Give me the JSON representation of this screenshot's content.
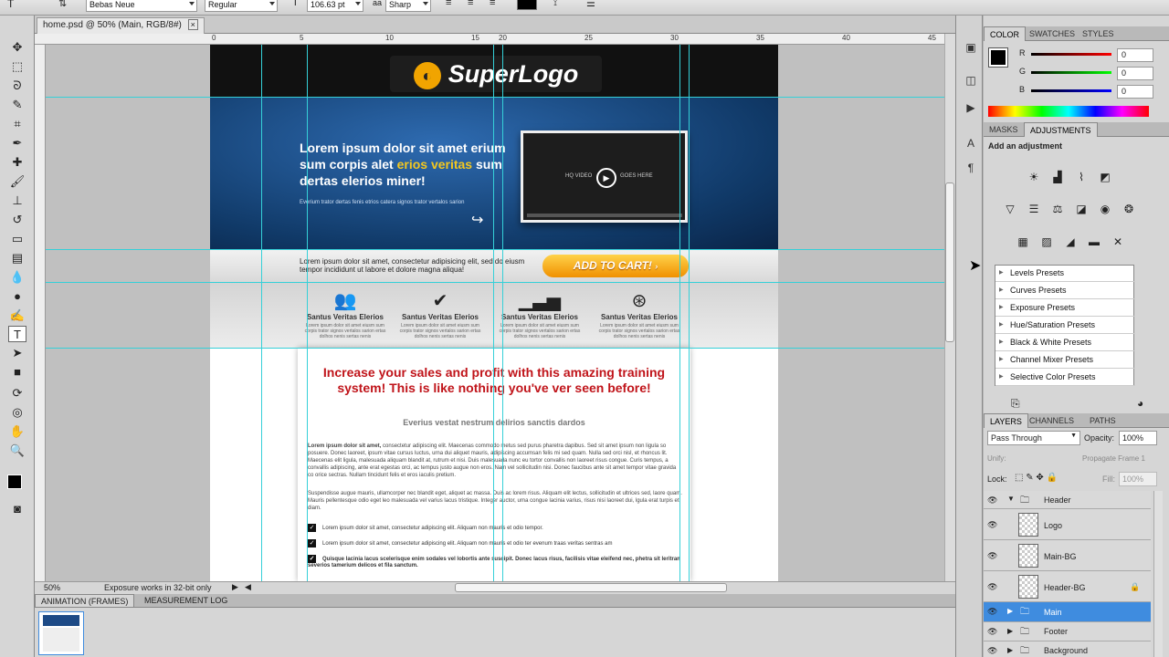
{
  "options_bar": {
    "font_family": "Bebas Neue",
    "font_style": "Regular",
    "font_size": "106.63 pt",
    "antialias": "Sharp"
  },
  "document": {
    "tab_title": "home.psd @ 50% (Main, RGB/8#)",
    "close": "×"
  },
  "ruler": {
    "labels": [
      "0",
      "5",
      "10",
      "15",
      "20",
      "25",
      "30",
      "35",
      "40",
      "45"
    ]
  },
  "status": {
    "zoom": "50%",
    "info": "Exposure works in 32-bit only"
  },
  "site": {
    "logo_text": "SuperLogo",
    "hero_title_1": "Lorem ipsum dolor sit amet erium sum corpis alet ",
    "hero_highlight": "erios veritas",
    "hero_title_2": " sum dertas elerios miner!",
    "hero_sub": "Everium trator dertas fenis etrios catera signos trator vertalos sarion",
    "video_left": "HQ VIDEO",
    "video_right": "GOES HERE",
    "cart_text": "Lorem ipsum dolor sit amet, consectetur adipisicing elit, sed do eiusm tempor incididunt ut labore et dolore magna aliqua!",
    "cart_button": "ADD TO CART!",
    "features": [
      {
        "title": "Santus Veritas Elerios",
        "desc": "Lorem ipsum dolor sit amet eiusm sum corpis trator signos vertalos sarion ertas dolhos nenis sertas nenis"
      },
      {
        "title": "Santus Veritas Elerios",
        "desc": "Lorem ipsum dolor sit amet eiusm sum corpis trator signos vertalos sarion ertas dolhos nenis sertas nenis"
      },
      {
        "title": "Santus Veritas Elerios",
        "desc": "Lorem ipsum dolor sit amet eiusm sum corpis trator signos vertalos sarion ertas dolhos nenis sertas nenis"
      },
      {
        "title": "Santus Veritas Elerios",
        "desc": "Lorem ipsum dolor sit amet eiusm sum corpis trator signos vertalos sarion ertas dolhos nenis sertas nenis"
      }
    ],
    "content_title": "Increase your sales and profit with this amazing training system! This is like nothing you've ver seen before!",
    "content_sub": "Everius vestat nestrum delirios sanctis dardos",
    "para1_bold": "Lorem ipsum dolor sit amet,",
    "para1": " consectetur adipiscing elit. Maecenas commodo metus sed purus pharetra dapibus. Sed sit amet ipsum non ligula so posuere. Donec laoreet, ipsum vitae cursus luctus, urna dui aliquet mauris, adipiscing accumsan felis mi sed quam. Nulla sed orci nisl, et rhoncus lit. Maecenas elit ligula, malesuada aliquam blandit at, rutrum et nisi. Duis malesuada nunc eu tortor convallis non laoreet risus congue. Curis tempus, a convallis adipiscing, ante erat egestas orci, ac tempus justo augue non eros. Nam vel sollicitudin nisi. Donec faucibus ante sit amet tempor vitae gravida co orice sectras. Nullam tincidunt felis et eros iaculis pretium.",
    "para2": "Suspendisse augue mauris, ullamcorper nec blandit eget, aliquet ac massa. Duis ac lorem risus. Aliquam elit lectus, sollicitudin et ultrices sed, laore quam. Mauris pellentesque odio eget leo malesuada vel varius lacus tristique. Integer auctor, urna congue lacinia varius, risus nisi laoreet dui, lgula erat turpis et diam.",
    "checks": [
      "Lorem ipsum dolor sit amet, consectetur adipiscing elit. Aliquam non mauris et odio tempor.",
      "Lorem ipsum dolor sit amet, consectetur adipiscing elit. Aliquam non mauris et odio ter evenum traas veritas sentras am",
      "Quisque lacinia lacus scelerisque enim sodales vel lobortis ante suscipit. Donec lacus risus, facilisis vitae eleifend nec, phetra sit leritran severios tamerium delicos et fila sanctum."
    ]
  },
  "panels": {
    "color_tabs": [
      "COLOR",
      "SWATCHES",
      "STYLES"
    ],
    "rgb_labels": [
      "R",
      "G",
      "B"
    ],
    "rgb_values": [
      "0",
      "0",
      "0"
    ],
    "adj_tabs": [
      "MASKS",
      "ADJUSTMENTS"
    ],
    "adj_heading": "Add an adjustment",
    "presets": [
      "Levels Presets",
      "Curves Presets",
      "Exposure Presets",
      "Hue/Saturation Presets",
      "Black & White Presets",
      "Channel Mixer Presets",
      "Selective Color Presets"
    ],
    "layer_tabs": [
      "LAYERS",
      "CHANNELS",
      "PATHS"
    ],
    "blend_mode": "Pass Through",
    "opacity_label": "Opacity:",
    "opacity": "100%",
    "unify": "Unify:",
    "propagate": "Propagate Frame 1",
    "lock_label": "Lock:",
    "fill_label": "Fill:",
    "fill": "100%",
    "layers": [
      "Header",
      "Logo",
      "Main-BG",
      "Header-BG",
      "Main",
      "Footer",
      "Background"
    ]
  },
  "bottom": {
    "tabs": [
      "ANIMATION (FRAMES)",
      "MEASUREMENT LOG"
    ]
  },
  "colors": {
    "accent": "#0a64d6",
    "selected_layer": "#3f8cdf"
  }
}
